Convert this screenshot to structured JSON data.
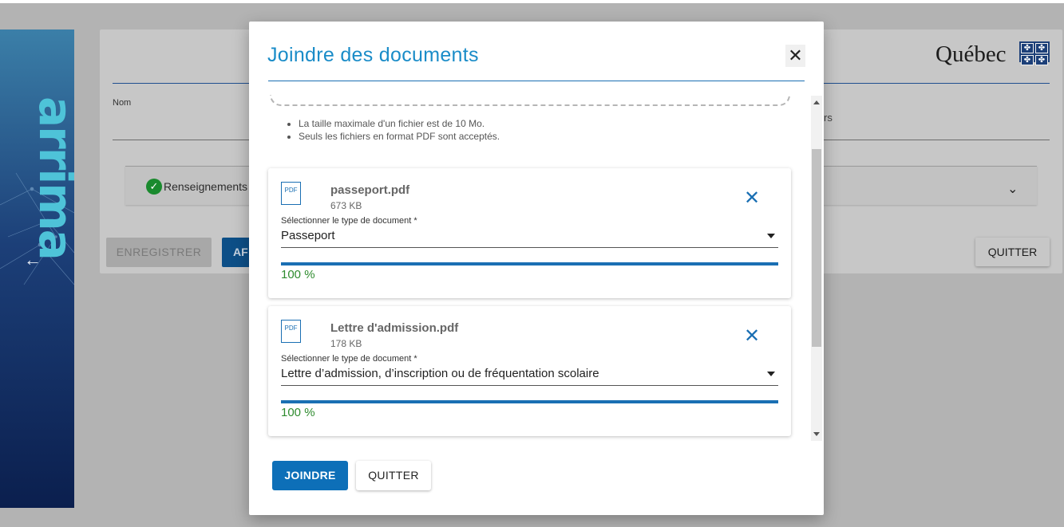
{
  "background": {
    "brand": "arrima",
    "government_logo": "Québec",
    "field_label_name": "Nom",
    "right_text": "rs",
    "accordion_label": "Renseignements",
    "save_button": "ENREGISTRER",
    "af_button": "AF",
    "quit_button": "QUITTER",
    "back_icon": "arrow-left-icon"
  },
  "modal": {
    "title": "Joindre des documents",
    "close_icon": "close-icon",
    "rules": [
      "La taille maximale d'un fichier est de 10 Mo.",
      "Seuls les fichiers en format PDF sont acceptés."
    ],
    "files": [
      {
        "icon_label": "PDF",
        "name": "passeport.pdf",
        "size": "673 KB",
        "type_label": "Sélectionner le type de document *",
        "type_value": "Passeport",
        "progress_fraction": 1.0,
        "progress_text": "100 %"
      },
      {
        "icon_label": "PDF",
        "name": "Lettre d'admission.pdf",
        "size": "178 KB",
        "type_label": "Sélectionner le type de document *",
        "type_value": "Lettre d’admission, d’inscription ou de fréquentation scolaire",
        "progress_fraction": 1.0,
        "progress_text": "100 %"
      }
    ],
    "join_button": "JOINDRE",
    "quit_button": "QUITTER"
  },
  "colors": {
    "accent": "#1a8cc8",
    "primary_button": "#0d6fb8",
    "success": "#2e8b2e"
  }
}
